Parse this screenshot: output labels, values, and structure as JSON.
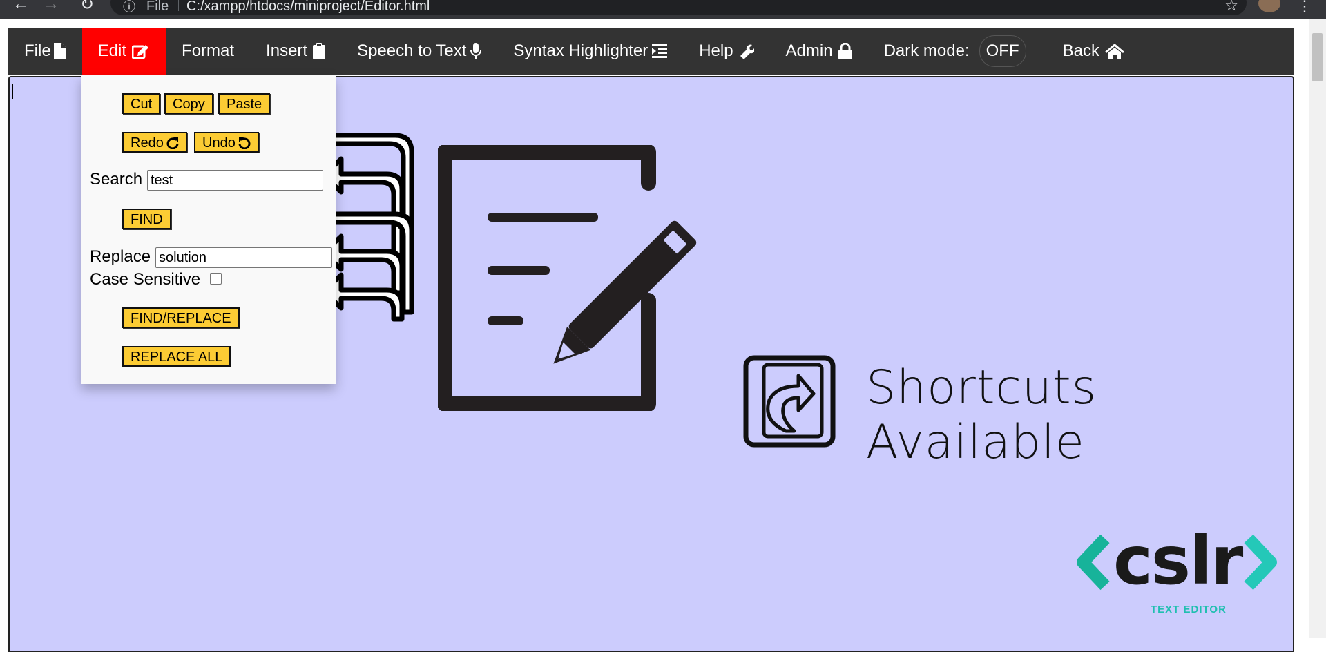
{
  "browser": {
    "scheme": "File",
    "url": "C:/xampp/htdocs/miniproject/Editor.html"
  },
  "navbar": {
    "items": [
      {
        "label": "File",
        "icon": "file-icon"
      },
      {
        "label": "Edit",
        "icon": "edit-icon",
        "active": true
      },
      {
        "label": "Format",
        "icon": ""
      },
      {
        "label": "Insert",
        "icon": "clipboard-icon"
      },
      {
        "label": "Speech to Text",
        "icon": "microphone-icon"
      },
      {
        "label": "Syntax Highlighter",
        "icon": "list-indent-icon"
      },
      {
        "label": "Help",
        "icon": "wrench-icon"
      },
      {
        "label": "Admin",
        "icon": "lock-icon"
      }
    ],
    "dark_mode_label": "Dark mode:",
    "dark_mode_value": "OFF",
    "back_label": "Back",
    "active_color": "#ff0000",
    "bar_color": "#333333"
  },
  "edit_menu": {
    "cut": "Cut",
    "copy": "Copy",
    "paste": "Paste",
    "redo": "Redo",
    "undo": "Undo",
    "search_label": "Search",
    "search_value": "test",
    "find": "FIND",
    "replace_label": "Replace",
    "replace_value": "solution",
    "case_sensitive_label": "Case Sensitive",
    "case_sensitive_checked": false,
    "find_replace": "FIND/REPLACE",
    "replace_all": "REPLACE ALL",
    "button_color": "#fccc34"
  },
  "editor": {
    "background": "#ccccfd",
    "shortcuts_text": "Shortcuts Available",
    "brand_name": "cslr",
    "brand_tagline": "TEXT EDITOR",
    "brand_accent": "#20bfb0"
  }
}
